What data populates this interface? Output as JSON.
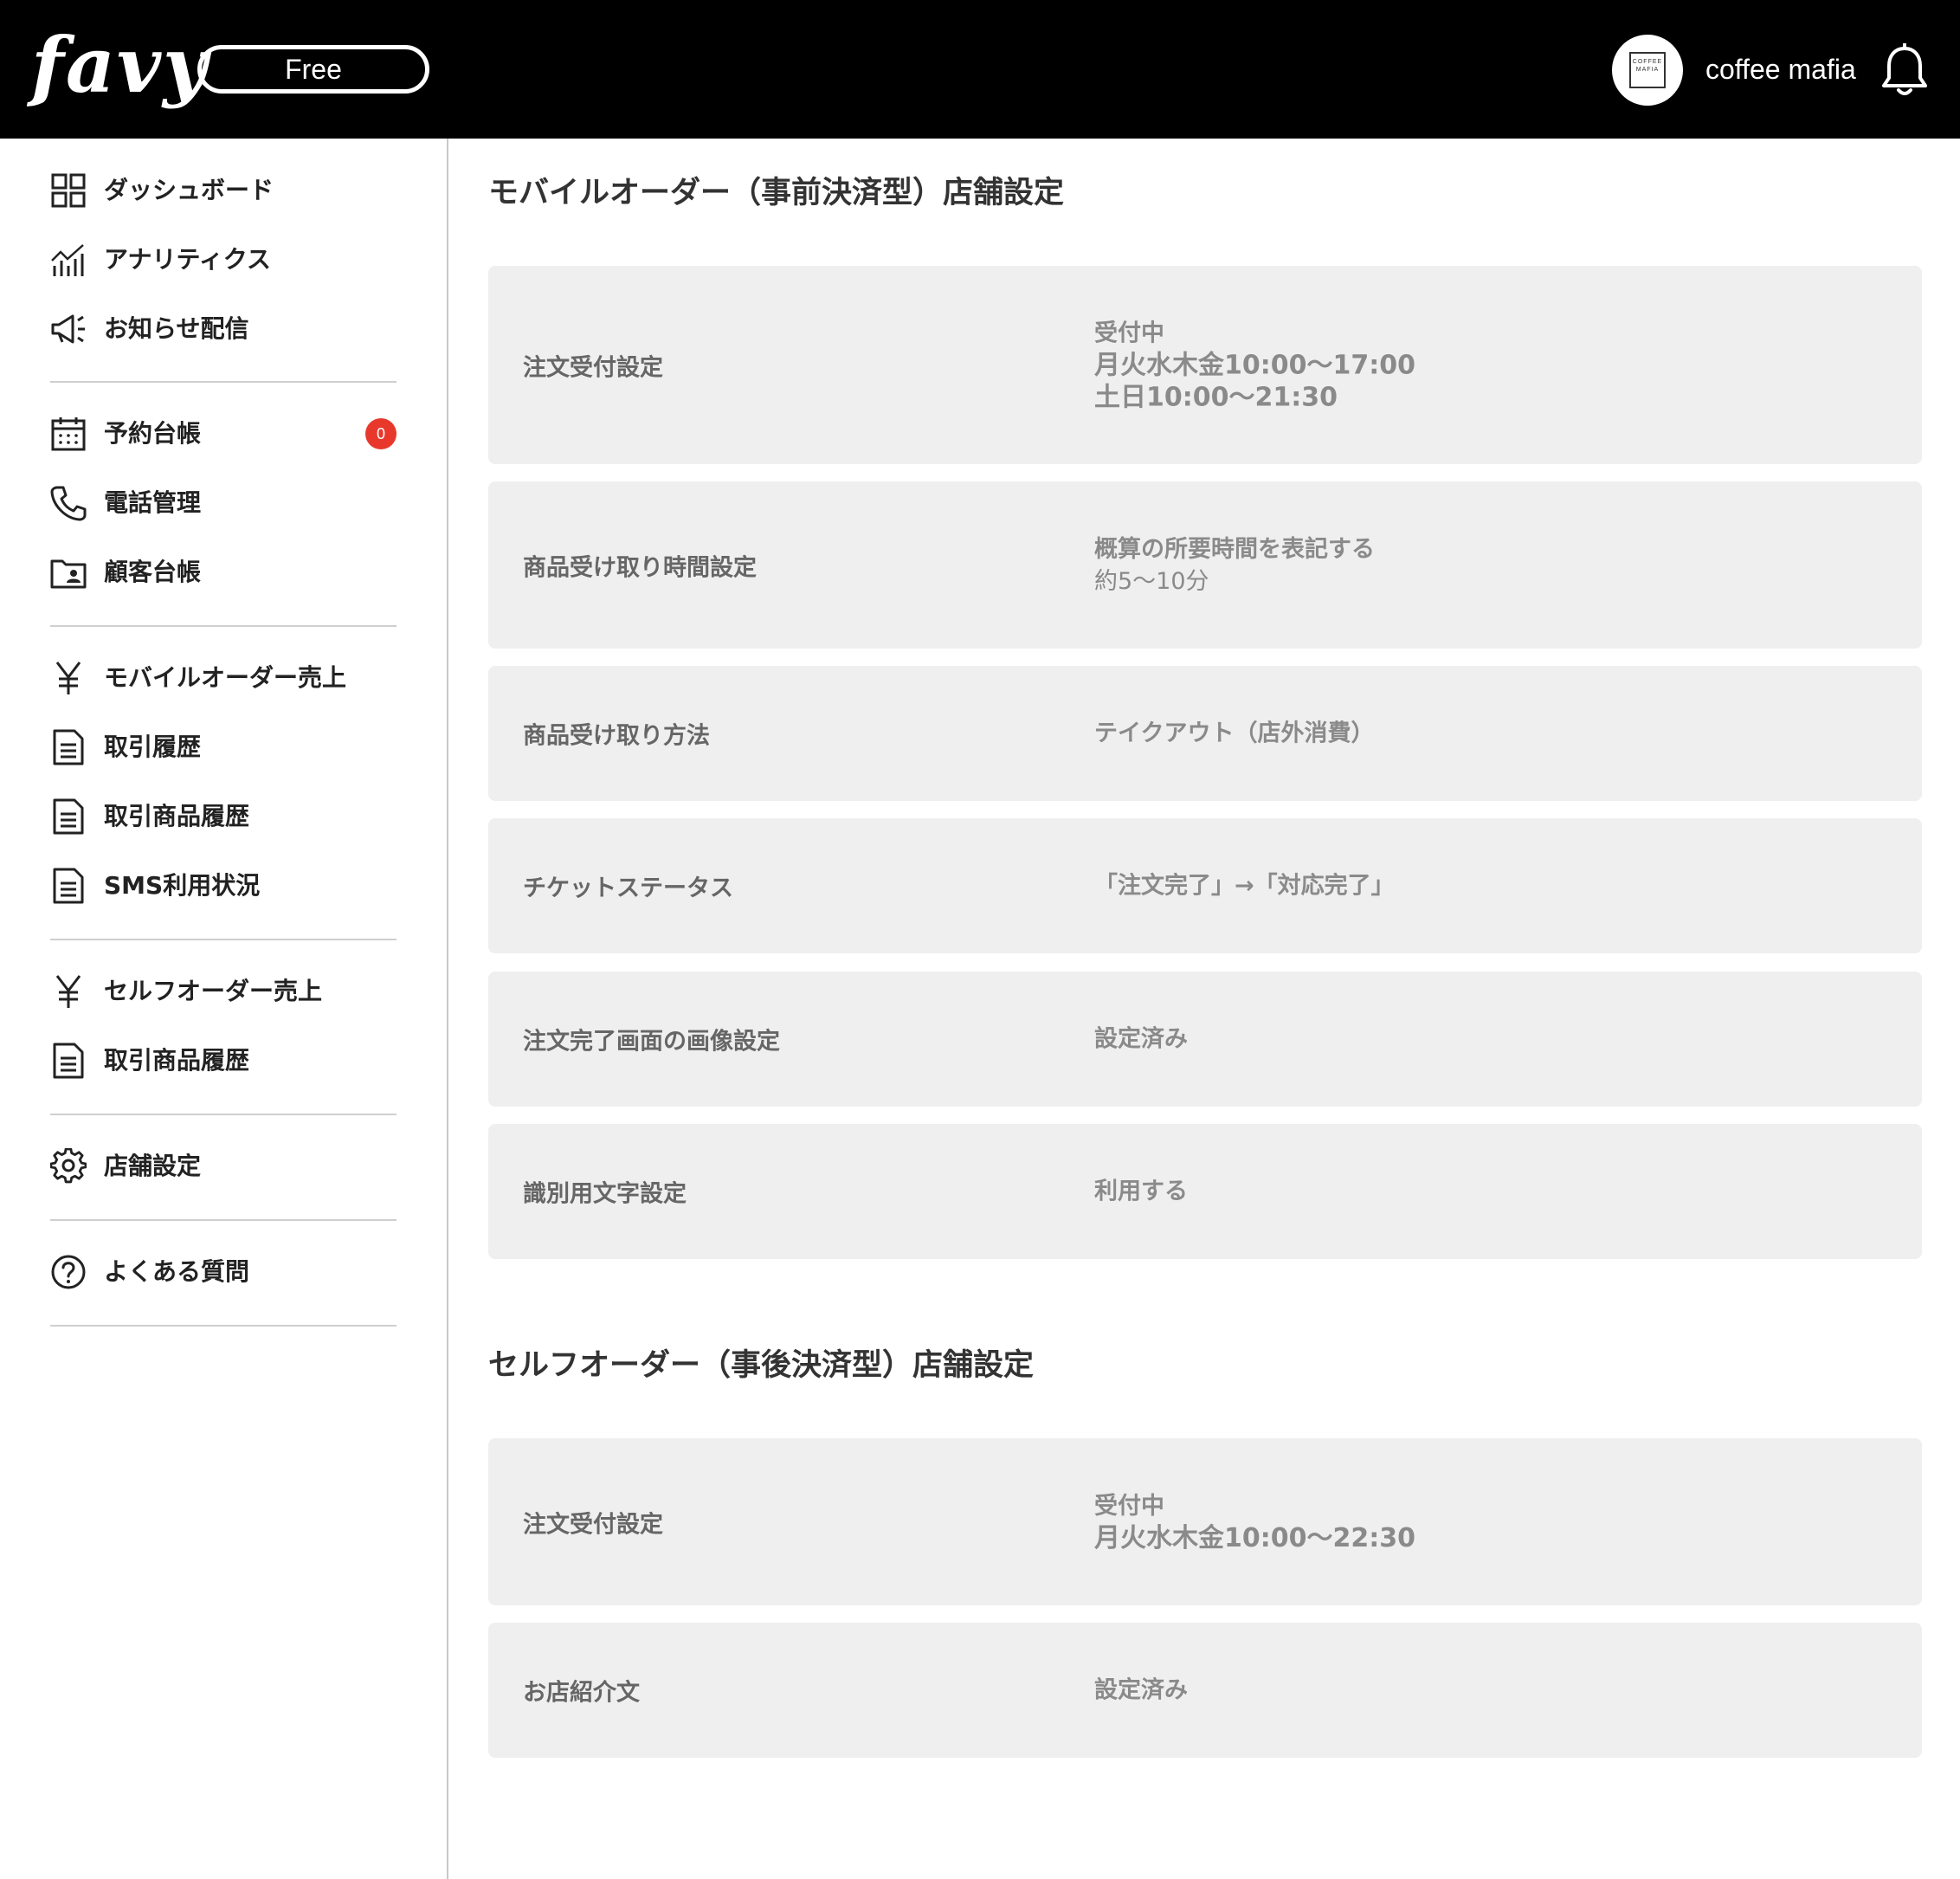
{
  "header": {
    "logo": "favy",
    "plan": "Free",
    "account_name": "coffee mafia",
    "avatar_text": "COFFEE MAFIA"
  },
  "sidebar": {
    "items": [
      {
        "label": "ダッシュボード",
        "icon": "dashboard-grid-icon"
      },
      {
        "label": "アナリティクス",
        "icon": "analytics-chart-icon"
      },
      {
        "label": "お知らせ配信",
        "icon": "megaphone-icon"
      },
      {
        "label": "予約台帳",
        "icon": "calendar-icon",
        "badge": "0"
      },
      {
        "label": "電話管理",
        "icon": "phone-icon"
      },
      {
        "label": "顧客台帳",
        "icon": "customer-folder-icon"
      },
      {
        "label": "モバイルオーダー売上",
        "icon": "yen-icon"
      },
      {
        "label": "取引履歴",
        "icon": "document-icon"
      },
      {
        "label": "取引商品履歴",
        "icon": "document-icon"
      },
      {
        "label": "SMS利用状況",
        "icon": "document-icon"
      },
      {
        "label": "セルフオーダー売上",
        "icon": "yen-icon"
      },
      {
        "label": "取引商品履歴",
        "icon": "document-icon"
      },
      {
        "label": "店舗設定",
        "icon": "gear-icon"
      },
      {
        "label": "よくある質問",
        "icon": "help-circle-icon"
      }
    ]
  },
  "mobile_section": {
    "title": "モバイルオーダー（事前決済型）店舗設定",
    "rows": [
      {
        "label": "注文受付設定",
        "status": "受付中",
        "line1": "月火水木金10:00〜17:00",
        "line2": "土日10:00〜21:30"
      },
      {
        "label": "商品受け取り時間設定",
        "value1": "概算の所要時間を表記する",
        "value2": "約5〜10分"
      },
      {
        "label": "商品受け取り方法",
        "value": "テイクアウト（店外消費）"
      },
      {
        "label": "チケットステータス",
        "value": "「注文完了」→「対応完了」"
      },
      {
        "label": "注文完了画面の画像設定",
        "value": "設定済み"
      },
      {
        "label": "識別用文字設定",
        "value": "利用する"
      }
    ]
  },
  "self_section": {
    "title": "セルフオーダー（事後決済型）店舗設定",
    "rows": [
      {
        "label": "注文受付設定",
        "status": "受付中",
        "line1": "月火水木金10:00〜22:30"
      },
      {
        "label": "お店紹介文",
        "value": "設定済み"
      }
    ]
  }
}
